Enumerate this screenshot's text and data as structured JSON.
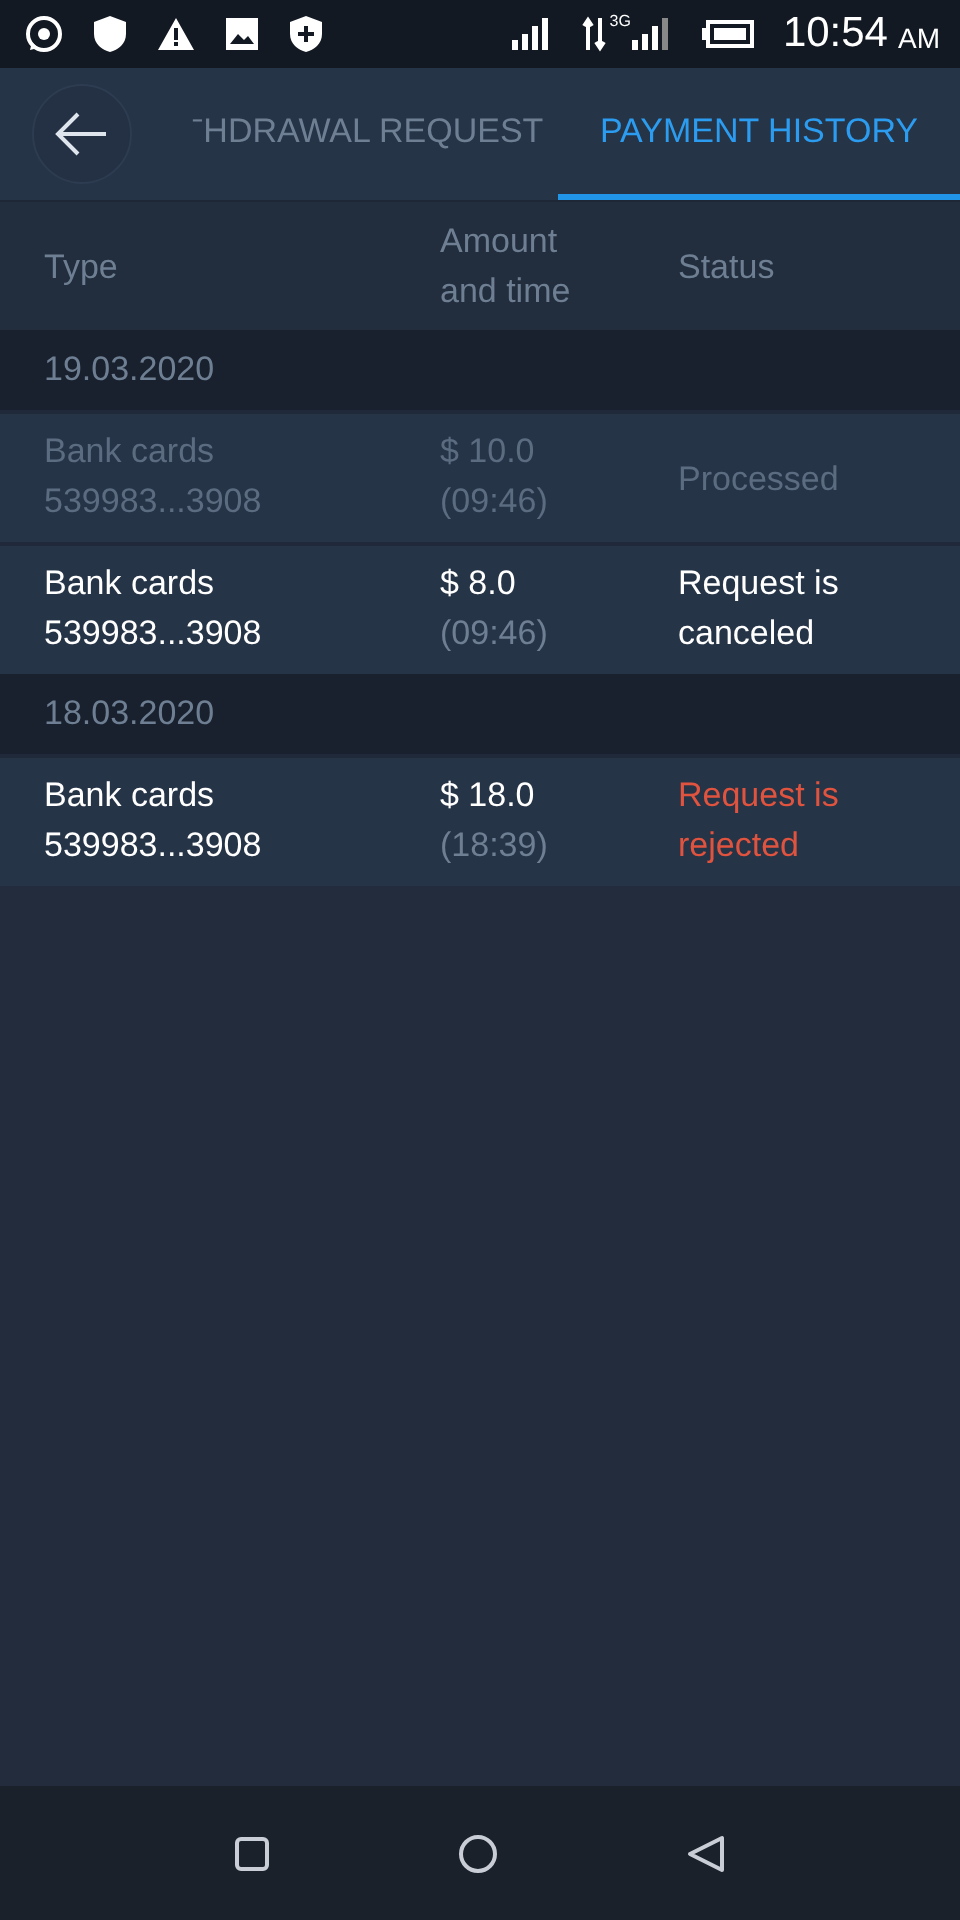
{
  "status_bar": {
    "network_label": "3G",
    "time": "10:54",
    "meridiem": "AM"
  },
  "header": {
    "tabs": [
      {
        "label": "ˉHDRAWAL REQUEST",
        "selected": false
      },
      {
        "label": "PAYMENT HISTORY",
        "selected": true
      }
    ]
  },
  "table": {
    "columns": [
      "Type",
      "Amount\nand time",
      "Status"
    ],
    "groups": [
      {
        "date": "19.03.2020",
        "rows": [
          {
            "type": "Bank cards",
            "card": "539983...3908",
            "amount": "$ 10.0",
            "time": "(09:46)",
            "status": "Processed",
            "kind": "processed"
          },
          {
            "type": "Bank cards",
            "card": "539983...3908",
            "amount": "$ 8.0",
            "time": "(09:46)",
            "status": "Request is\ncanceled",
            "kind": "canceled"
          }
        ]
      },
      {
        "date": "18.03.2020",
        "rows": [
          {
            "type": "Bank cards",
            "card": "539983...3908",
            "amount": "$ 18.0",
            "time": "(18:39)",
            "status": "Request is\nrejected",
            "kind": "rejected"
          }
        ]
      }
    ]
  }
}
